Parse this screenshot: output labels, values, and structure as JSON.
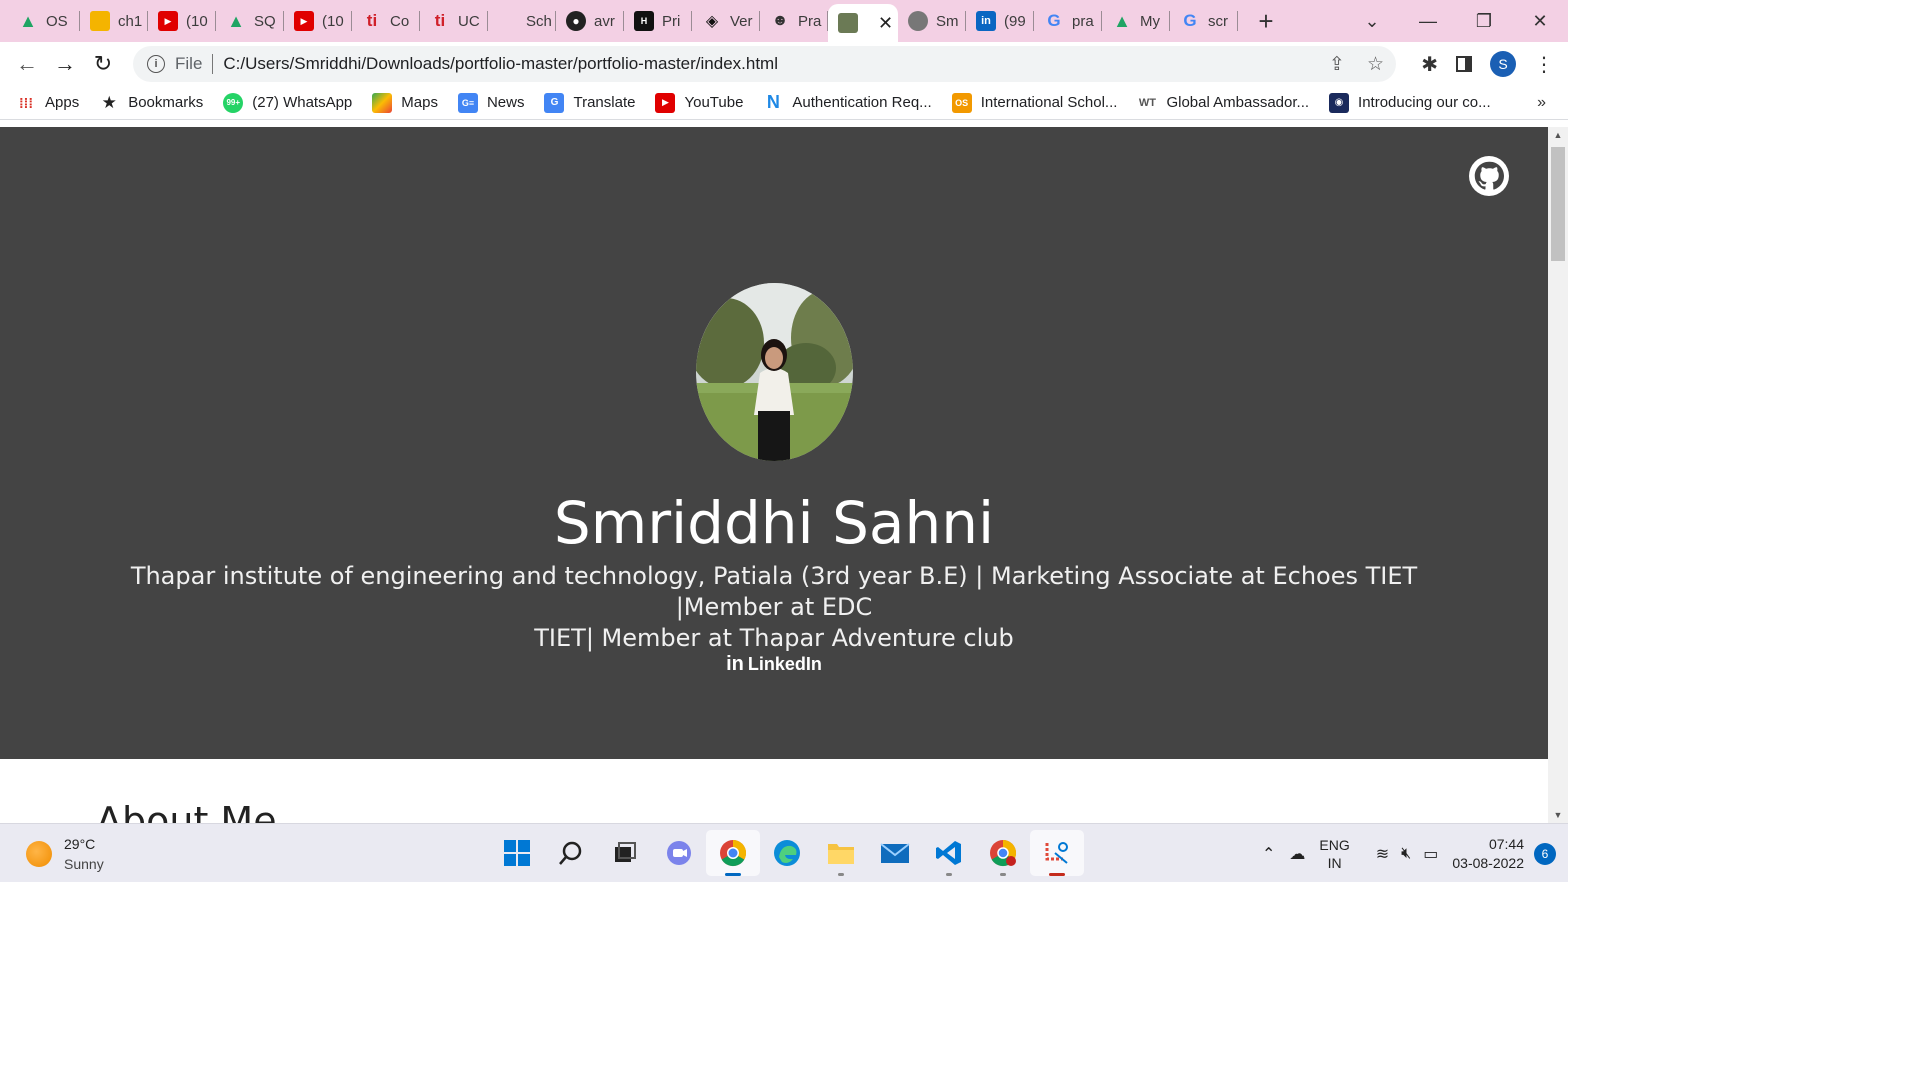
{
  "browser": {
    "tabs": [
      {
        "label": "OS",
        "icon": "google-drive-icon",
        "color": "#1fa463"
      },
      {
        "label": "ch1",
        "icon": "google-slides-icon",
        "color": "#f4b400"
      },
      {
        "label": "(10",
        "icon": "youtube-icon",
        "color": "#e00000"
      },
      {
        "label": "SQ",
        "icon": "google-drive-icon",
        "color": "#1fa463"
      },
      {
        "label": "(10",
        "icon": "youtube-icon",
        "color": "#e00000"
      },
      {
        "label": "Co",
        "icon": "ti-icon",
        "color": "#d0202a"
      },
      {
        "label": "UC",
        "icon": "ti-icon",
        "color": "#d0202a"
      },
      {
        "label": "Sch",
        "icon": "blank-icon",
        "color": "#f3d0e4"
      },
      {
        "label": "avr",
        "icon": "github-icon",
        "color": "#222222"
      },
      {
        "label": "Pri",
        "icon": "hackerrank-icon",
        "color": "#111111"
      },
      {
        "label": "Ver",
        "icon": "codepen-icon",
        "color": "#111111"
      },
      {
        "label": "Pra",
        "icon": "avatar-icon",
        "color": "#333333"
      },
      {
        "label": "",
        "icon": "photo-icon",
        "color": "#6b7a55",
        "active": true
      },
      {
        "label": "Sm",
        "icon": "globe-icon",
        "color": "#666666"
      },
      {
        "label": "(99",
        "icon": "linkedin-icon",
        "color": "#0a66c2"
      },
      {
        "label": "pra",
        "icon": "google-icon",
        "color": "#4285f4"
      },
      {
        "label": "My",
        "icon": "google-drive-icon",
        "color": "#1fa463"
      },
      {
        "label": "scr",
        "icon": "google-icon",
        "color": "#4285f4"
      }
    ],
    "file_label": "File",
    "url": "C:/Users/Smriddhi/Downloads/portfolio-master/portfolio-master/index.html",
    "profile_initial": "S",
    "bookmarks": [
      {
        "label": "Apps",
        "icon": "apps-grid-icon"
      },
      {
        "label": "Bookmarks",
        "icon": "star-icon"
      },
      {
        "label": "(27) WhatsApp",
        "icon": "whatsapp-icon"
      },
      {
        "label": "Maps",
        "icon": "maps-icon"
      },
      {
        "label": "News",
        "icon": "google-news-icon"
      },
      {
        "label": "Translate",
        "icon": "translate-icon"
      },
      {
        "label": "YouTube",
        "icon": "youtube-icon"
      },
      {
        "label": "Authentication Req...",
        "icon": "n-icon"
      },
      {
        "label": "International Schol...",
        "icon": "os-icon"
      },
      {
        "label": "Global Ambassador...",
        "icon": "wt-icon"
      },
      {
        "label": "Introducing our co...",
        "icon": "shield-icon"
      }
    ],
    "bookmarks_more": "»"
  },
  "page": {
    "name": "Smriddhi Sahni",
    "tagline_line1": "Thapar institute of engineering and technology, Patiala (3rd year B.E) | Marketing Associate at Echoes TIET |Member at EDC",
    "tagline_line2": "TIET| Member at Thapar Adventure club",
    "linkedin_icon_text": "in",
    "linkedin_label": "LinkedIn",
    "about_heading": "About Me",
    "hero_color": "#444444"
  },
  "taskbar": {
    "temperature": "29°C",
    "condition": "Sunny",
    "lang_line1": "ENG",
    "lang_line2": "IN",
    "time": "07:44",
    "date": "03-08-2022",
    "notifications": "6"
  }
}
